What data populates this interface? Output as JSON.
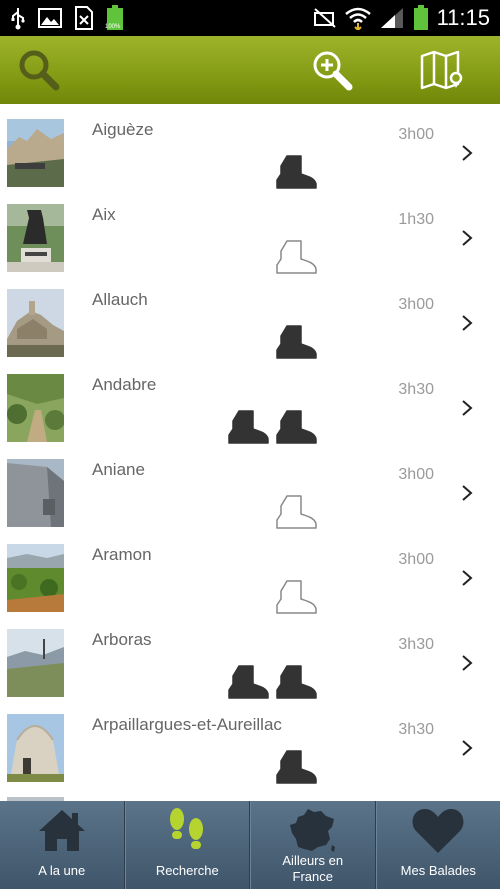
{
  "status_bar": {
    "time": "11:15",
    "battery_small_label": "100%",
    "icons": [
      "usb-icon",
      "image-icon",
      "sim-icon",
      "battery-small-icon",
      "mute-icon",
      "wifi-icon",
      "signal-icon",
      "battery-icon"
    ]
  },
  "action_bar": {
    "buttons": [
      "search-icon",
      "zoom-in-icon",
      "map-icon"
    ],
    "accent_color": "#8aa11a"
  },
  "walks": [
    {
      "name": "Aiguèze",
      "duration": "3h00",
      "difficulty": 1,
      "filled": true,
      "thumb": "village-rock"
    },
    {
      "name": "Aix",
      "duration": "1h30",
      "difficulty": 1,
      "filled": false,
      "thumb": "statue"
    },
    {
      "name": "Allauch",
      "duration": "3h00",
      "difficulty": 1,
      "filled": true,
      "thumb": "hill-chapel"
    },
    {
      "name": "Andabre",
      "duration": "3h30",
      "difficulty": 2,
      "filled": true,
      "thumb": "forest-path"
    },
    {
      "name": "Aniane",
      "duration": "3h00",
      "difficulty": 1,
      "filled": false,
      "thumb": "stone-wall"
    },
    {
      "name": "Aramon",
      "duration": "3h00",
      "difficulty": 1,
      "filled": false,
      "thumb": "garrigue"
    },
    {
      "name": "Arboras",
      "duration": "3h30",
      "difficulty": 2,
      "filled": true,
      "thumb": "valley"
    },
    {
      "name": "Arpaillargues-et-Aureillac",
      "duration": "3h30",
      "difficulty": 1,
      "filled": true,
      "thumb": "capitelle"
    }
  ],
  "tabs": [
    {
      "label": "A la une",
      "icon": "home-icon"
    },
    {
      "label": "Recherche",
      "icon": "footprints-icon"
    },
    {
      "label": "Ailleurs en France",
      "icon": "france-map-icon"
    },
    {
      "label": "Mes Balades",
      "icon": "heart-icon"
    }
  ],
  "colors": {
    "tab_bar": "#4d6478",
    "footprints": "#b5d430",
    "boot_filled": "#333333",
    "boot_outline": "#888888"
  }
}
